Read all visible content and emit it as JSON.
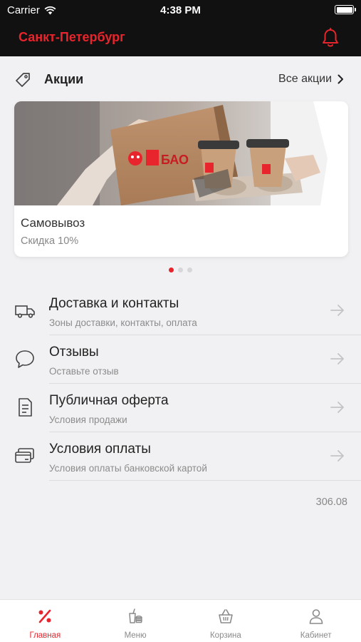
{
  "status_bar": {
    "carrier": "Carrier",
    "time": "4:38 PM"
  },
  "header": {
    "city": "Санкт-Петербург",
    "accent": "#e8242c"
  },
  "promotions": {
    "title": "Акции",
    "all_label": "Все акции",
    "card": {
      "name": "Самовывоз",
      "description": "Скидка 10%",
      "brand_text": "БАО"
    },
    "pager": {
      "count": 3,
      "active": 1
    }
  },
  "menu": [
    {
      "icon": "truck-icon",
      "title": "Доставка и контакты",
      "subtitle": "Зоны доставки, контакты, оплата"
    },
    {
      "icon": "chat-bubble-icon",
      "title": "Отзывы",
      "subtitle": "Оставьте отзыв"
    },
    {
      "icon": "document-icon",
      "title": "Публичная оферта",
      "subtitle": "Условия продажи"
    },
    {
      "icon": "credit-cards-icon",
      "title": "Условия оплаты",
      "subtitle": "Условия оплаты банковской картой"
    }
  ],
  "version": "306.08",
  "tabs": [
    {
      "icon": "percent-icon",
      "label": "Главная",
      "active": true
    },
    {
      "icon": "food-menu-icon",
      "label": "Меню",
      "active": false
    },
    {
      "icon": "basket-icon",
      "label": "Корзина",
      "active": false
    },
    {
      "icon": "user-icon",
      "label": "Кабинет",
      "active": false
    }
  ]
}
